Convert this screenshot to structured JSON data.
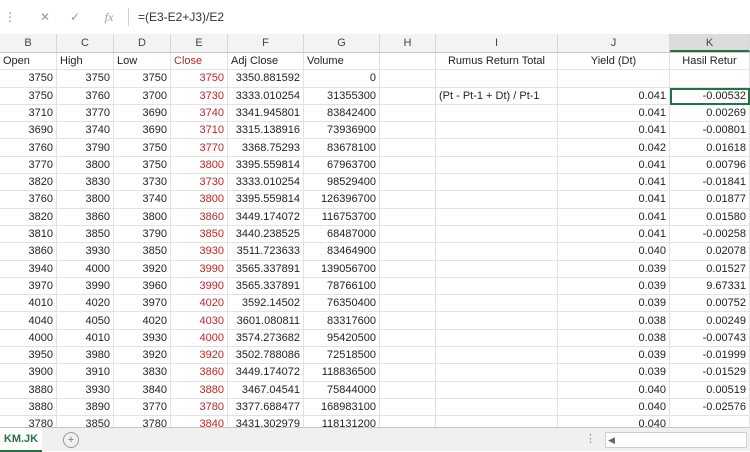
{
  "formula_bar": {
    "cancel_glyph": "✕",
    "confirm_glyph": "✓",
    "fx_label": "fx",
    "formula": "=(E3-E2+J3)/E2"
  },
  "columns": [
    "B",
    "C",
    "D",
    "E",
    "F",
    "G",
    "H",
    "I",
    "J",
    "K"
  ],
  "header_row": {
    "b": "Open",
    "c": "High",
    "d": "Low",
    "e": "Close",
    "f": "Adj Close",
    "g": "Volume",
    "h": "",
    "i": "Rumus Return Total",
    "j": "Yield (Dt)",
    "k": "Hasil Retur"
  },
  "formula_note": "(Pt - Pt-1 + Dt) / Pt-1",
  "rows": [
    {
      "b": "3750",
      "c": "3750",
      "d": "3750",
      "e": "3750",
      "f": "3350.881592",
      "g": "0",
      "j": "",
      "k": ""
    },
    {
      "b": "3750",
      "c": "3760",
      "d": "3700",
      "e": "3730",
      "f": "3333.010254",
      "g": "31355300",
      "j": "0.041",
      "k": "-0.00532"
    },
    {
      "b": "3710",
      "c": "3770",
      "d": "3690",
      "e": "3740",
      "f": "3341.945801",
      "g": "83842400",
      "j": "0.041",
      "k": "0.00269"
    },
    {
      "b": "3690",
      "c": "3740",
      "d": "3690",
      "e": "3710",
      "f": "3315.138916",
      "g": "73936900",
      "j": "0.041",
      "k": "-0.00801"
    },
    {
      "b": "3760",
      "c": "3790",
      "d": "3750",
      "e": "3770",
      "f": "3368.75293",
      "g": "83678100",
      "j": "0.042",
      "k": "0.01618"
    },
    {
      "b": "3770",
      "c": "3800",
      "d": "3750",
      "e": "3800",
      "f": "3395.559814",
      "g": "67963700",
      "j": "0.041",
      "k": "0.00796"
    },
    {
      "b": "3820",
      "c": "3830",
      "d": "3730",
      "e": "3730",
      "f": "3333.010254",
      "g": "98529400",
      "j": "0.041",
      "k": "-0.01841"
    },
    {
      "b": "3760",
      "c": "3800",
      "d": "3740",
      "e": "3800",
      "f": "3395.559814",
      "g": "126396700",
      "j": "0.041",
      "k": "0.01877"
    },
    {
      "b": "3820",
      "c": "3860",
      "d": "3800",
      "e": "3860",
      "f": "3449.174072",
      "g": "116753700",
      "j": "0.041",
      "k": "0.01580"
    },
    {
      "b": "3810",
      "c": "3850",
      "d": "3790",
      "e": "3850",
      "f": "3440.238525",
      "g": "68487000",
      "j": "0.041",
      "k": "-0.00258"
    },
    {
      "b": "3860",
      "c": "3930",
      "d": "3850",
      "e": "3930",
      "f": "3511.723633",
      "g": "83464900",
      "j": "0.040",
      "k": "0.02078"
    },
    {
      "b": "3940",
      "c": "4000",
      "d": "3920",
      "e": "3990",
      "f": "3565.337891",
      "g": "139056700",
      "j": "0.039",
      "k": "0.01527"
    },
    {
      "b": "3970",
      "c": "3990",
      "d": "3960",
      "e": "3990",
      "f": "3565.337891",
      "g": "78766100",
      "j": "0.039",
      "k": "9.67331"
    },
    {
      "b": "4010",
      "c": "4020",
      "d": "3970",
      "e": "4020",
      "f": "3592.14502",
      "g": "76350400",
      "j": "0.039",
      "k": "0.00752"
    },
    {
      "b": "4040",
      "c": "4050",
      "d": "4020",
      "e": "4030",
      "f": "3601.080811",
      "g": "83317600",
      "j": "0.038",
      "k": "0.00249"
    },
    {
      "b": "4000",
      "c": "4010",
      "d": "3930",
      "e": "4000",
      "f": "3574.273682",
      "g": "95420500",
      "j": "0.038",
      "k": "-0.00743"
    },
    {
      "b": "3950",
      "c": "3980",
      "d": "3920",
      "e": "3920",
      "f": "3502.788086",
      "g": "72518500",
      "j": "0.039",
      "k": "-0.01999"
    },
    {
      "b": "3900",
      "c": "3910",
      "d": "3830",
      "e": "3860",
      "f": "3449.174072",
      "g": "118836500",
      "j": "0.039",
      "k": "-0.01529"
    },
    {
      "b": "3880",
      "c": "3930",
      "d": "3840",
      "e": "3880",
      "f": "3467.04541",
      "g": "75844000",
      "j": "0.040",
      "k": "0.00519"
    },
    {
      "b": "3880",
      "c": "3890",
      "d": "3770",
      "e": "3780",
      "f": "3377.688477",
      "g": "168983100",
      "j": "0.040",
      "k": "-0.02576"
    },
    {
      "b": "3780",
      "c": "3850",
      "d": "3780",
      "e": "3840",
      "f": "3431.302979",
      "g": "118131200",
      "j": "0.040",
      "k": ""
    }
  ],
  "sheet_tab": {
    "label": "KM.JK"
  },
  "add_sheet_glyph": "+",
  "scroll_dots": "⋮",
  "colors": {
    "close_red": "#b52a2a",
    "excel_green": "#217346"
  }
}
